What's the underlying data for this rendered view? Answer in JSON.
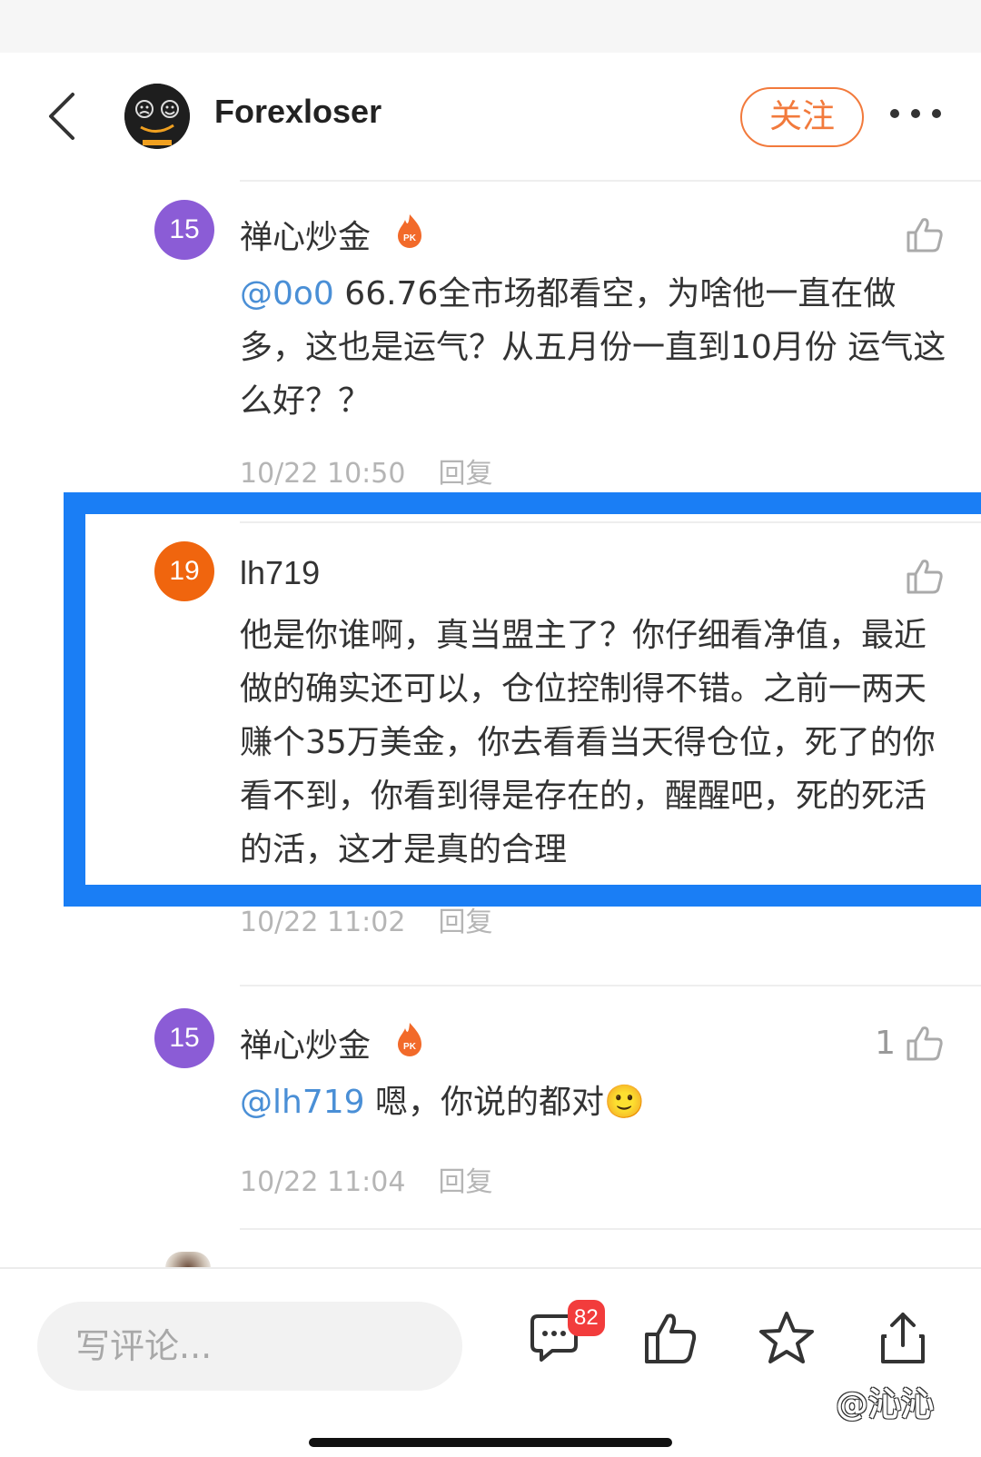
{
  "header": {
    "username": "Forexloser",
    "follow_label": "关注"
  },
  "comments": [
    {
      "level": "15",
      "name": "禅心炒金",
      "mention": "@0o0",
      "text": " 66.76全市场都看空，为啥他一直在做多，这也是运气？从五月份一直到10月份 运气这么好？？",
      "time": "10/22 10:50",
      "reply_label": "回复",
      "likes": ""
    },
    {
      "level": "19",
      "name": "lh719",
      "mention": "",
      "text": "他是你谁啊，真当盟主了？你仔细看净值，最近做的确实还可以，仓位控制得不错。之前一两天赚个35万美金，你去看看当天得仓位，死了的你看不到，你看到得是存在的，醒醒吧，死的死活的活，这才是真的合理",
      "time": "10/22 11:02",
      "reply_label": "回复",
      "likes": ""
    },
    {
      "level": "15",
      "name": "禅心炒金",
      "mention": "@lh719",
      "text": " 嗯，你说的都对",
      "emoji": "🙂",
      "time": "10/22 11:04",
      "reply_label": "回复",
      "likes": "1"
    }
  ],
  "bottom_bar": {
    "input_placeholder": "写评论...",
    "comment_count": "82",
    "watermark": "@沁沁"
  },
  "colors": {
    "accent_orange": "#f27a3c",
    "highlight_blue": "#1a7ef5",
    "mention_blue": "#4a8fd6",
    "badge_purple": "#8b5cd6",
    "badge_orange": "#f0650e",
    "badge_red": "#f23c3c"
  },
  "icons": [
    "back-arrow-icon",
    "avatar-face-icon",
    "more-dots-icon",
    "pk-fire-icon",
    "thumbs-up-icon",
    "comment-bubble-icon",
    "star-icon",
    "share-icon"
  ]
}
